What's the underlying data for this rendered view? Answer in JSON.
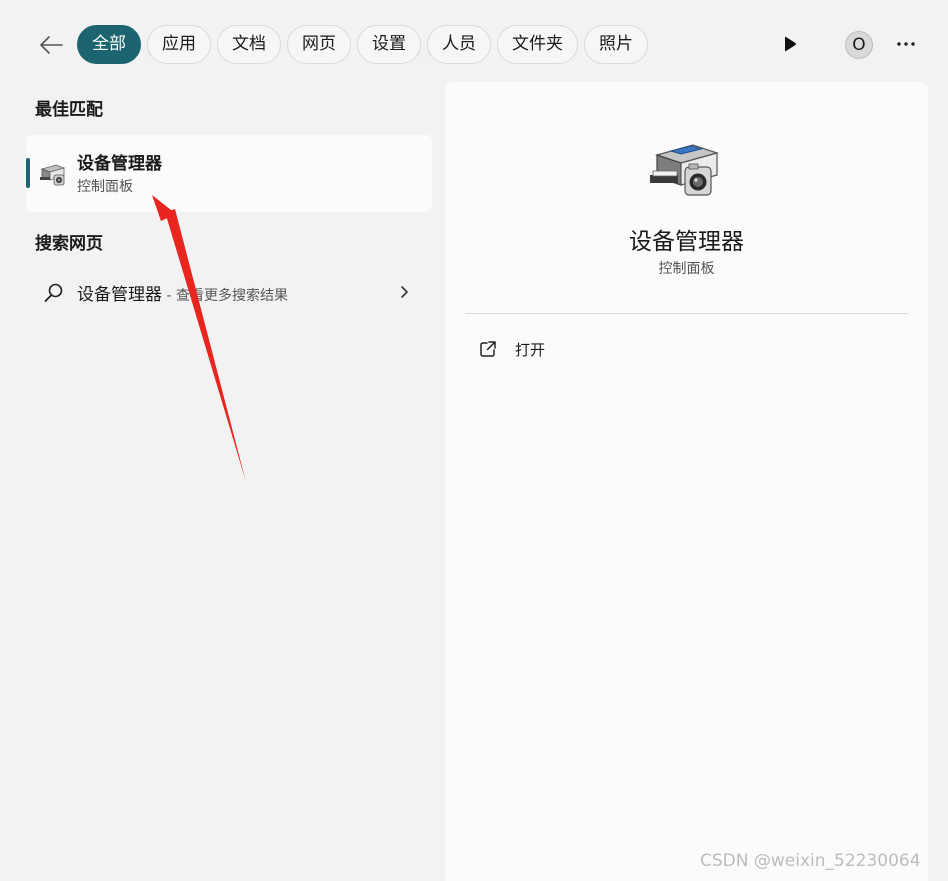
{
  "filters": {
    "tabs": [
      {
        "label": "全部",
        "active": true
      },
      {
        "label": "应用",
        "active": false
      },
      {
        "label": "文档",
        "active": false
      },
      {
        "label": "网页",
        "active": false
      },
      {
        "label": "设置",
        "active": false
      },
      {
        "label": "人员",
        "active": false
      },
      {
        "label": "文件夹",
        "active": false
      },
      {
        "label": "照片",
        "active": false
      }
    ]
  },
  "header": {
    "avatar_initial": "O",
    "icons": [
      "back-arrow-icon",
      "play-icon",
      "more-icon"
    ]
  },
  "best_match": {
    "section_title": "最佳匹配",
    "item": {
      "title": "设备管理器",
      "subtitle": "控制面板",
      "icon": "device-manager-icon"
    }
  },
  "web_search": {
    "section_title": "搜索网页",
    "item": {
      "query": "设备管理器",
      "suffix": " - 查看更多搜索结果"
    }
  },
  "preview": {
    "title": "设备管理器",
    "subtitle": "控制面板",
    "actions": [
      {
        "label": "打开",
        "icon": "open-external-icon"
      }
    ]
  },
  "watermark": "CSDN @weixin_52230064",
  "colors": {
    "accent": "#1c6470",
    "annotation_arrow": "#e8251f"
  }
}
